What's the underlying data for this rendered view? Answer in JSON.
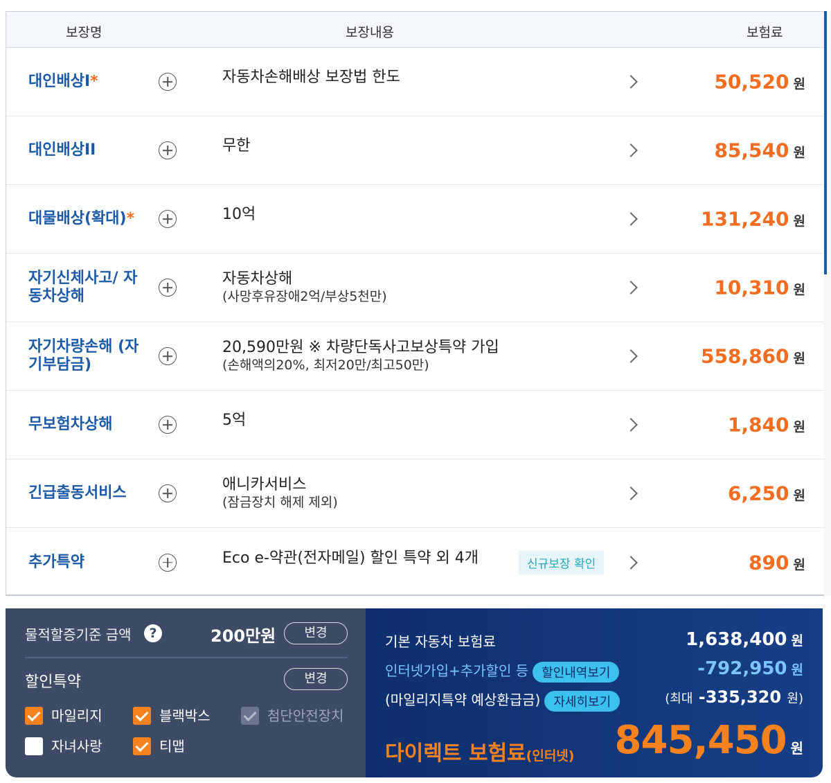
{
  "table": {
    "headers": {
      "name": "보장명",
      "content": "보장내용",
      "premium": "보험료"
    },
    "rows": [
      {
        "name": "대인배상I",
        "star": "*",
        "content": "자동차손해배상 보장법 한도",
        "sub": "",
        "badge": "",
        "amount": "50,520",
        "unit": "원"
      },
      {
        "name": "대인배상II",
        "star": "",
        "content": "무한",
        "sub": "",
        "badge": "",
        "amount": "85,540",
        "unit": "원"
      },
      {
        "name": "대물배상(확대)",
        "star": "*",
        "content": "10억",
        "sub": "",
        "badge": "",
        "amount": "131,240",
        "unit": "원"
      },
      {
        "name": "자기신체사고/ 자동차상해",
        "star": "",
        "content": "자동차상해",
        "sub": "(사망후유장애2억/부상5천만)",
        "badge": "",
        "amount": "10,310",
        "unit": "원"
      },
      {
        "name": "자기차량손해 (자기부담금)",
        "star": "",
        "content": "20,590만원 ※ 차량단독사고보상특약 가입",
        "sub": "(손해액의20%, 최저20만/최고50만)",
        "badge": "",
        "amount": "558,860",
        "unit": "원"
      },
      {
        "name": "무보험차상해",
        "star": "",
        "content": "5억",
        "sub": "",
        "badge": "",
        "amount": "1,840",
        "unit": "원"
      },
      {
        "name": "긴급출동서비스",
        "star": "",
        "content": "애니카서비스",
        "sub": "(잠금장치 해제 제외)",
        "badge": "",
        "amount": "6,250",
        "unit": "원"
      },
      {
        "name": "추가특약",
        "star": "",
        "content": "Eco e-약관(전자메일) 할인 특약 외 4개",
        "sub": "",
        "badge": "신규보장 확인",
        "amount": "890",
        "unit": "원"
      }
    ]
  },
  "left_panel": {
    "surcharge_label": "물적할증기준 금액",
    "surcharge_help": "?",
    "surcharge_amount": "200만원",
    "change_label": "변경",
    "discount_label": "할인특약",
    "checkboxes": [
      {
        "label": "마일리지",
        "state": "checked"
      },
      {
        "label": "블랙박스",
        "state": "checked"
      },
      {
        "label": "첨단안전장치",
        "state": "disabled"
      },
      {
        "label": "자녀사랑",
        "state": "unchecked"
      },
      {
        "label": "티맵",
        "state": "checked"
      }
    ]
  },
  "right_panel": {
    "base_label": "기본 자동차 보험료",
    "base_amount": "1,638,400",
    "discount_label": "인터넷가입+추가할인 등",
    "discount_button": "할인내역보기",
    "discount_amount": "-792,950",
    "mileage_label": "(마일리지특약 예상환급금)",
    "mileage_button": "자세히보기",
    "mileage_prefix": "(최대",
    "mileage_amount": "-335,320",
    "mileage_suffix": "원)",
    "direct_label": "다이렉트 보험료",
    "direct_sub": "(인터넷)",
    "direct_amount": "845,450",
    "unit": "원"
  },
  "colors": {
    "name_blue": "#1c5aa8",
    "price_orange": "#f26d21",
    "panel_left": "#3d4b66",
    "panel_right": "#0f2f6e",
    "checkbox_orange": "#f5821f",
    "pill_cyan": "#3cc1ef"
  }
}
